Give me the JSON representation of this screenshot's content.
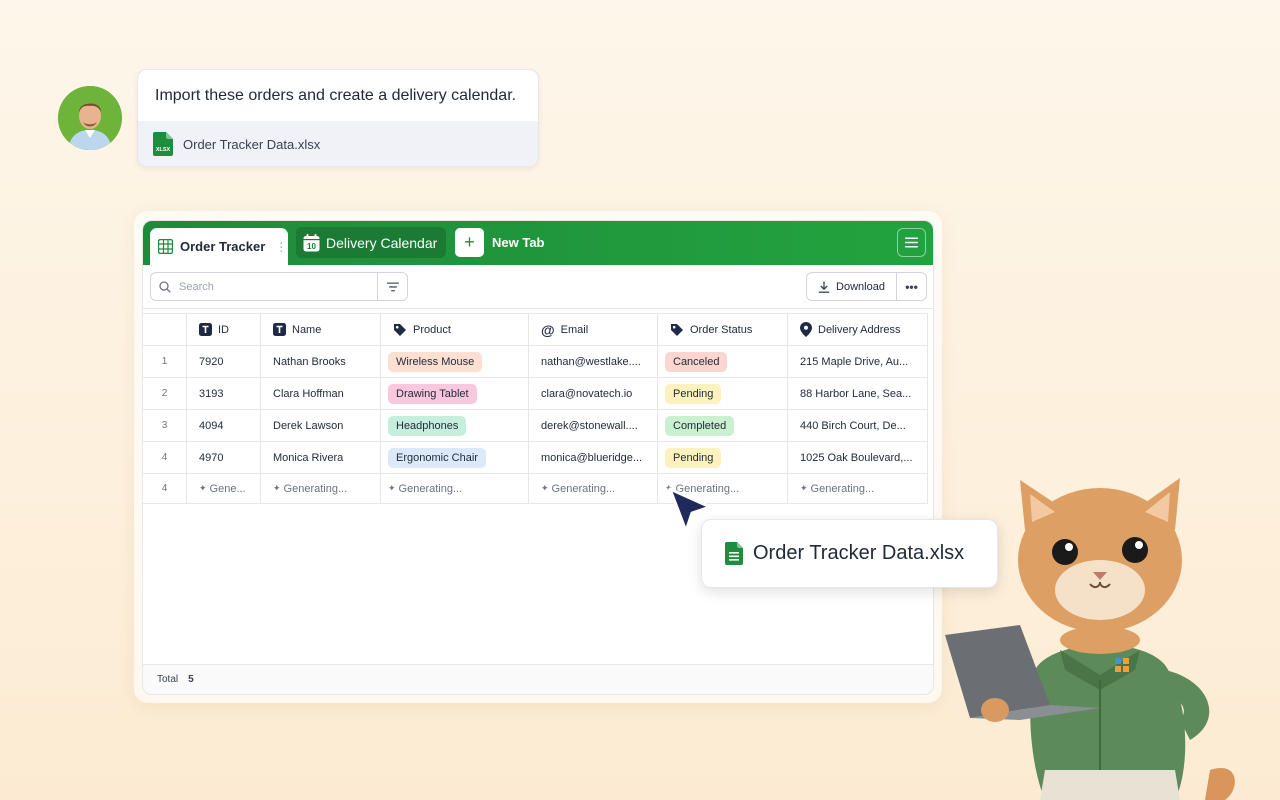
{
  "chat": {
    "message": "Import these orders and create a delivery calendar.",
    "attachment_name": "Order Tracker Data.xlsx",
    "attachment_badge": "XLSX"
  },
  "tabs": {
    "active_label": "Order Tracker",
    "calendar_label": "Delivery Calendar",
    "calendar_day": "10",
    "new_label": "New Tab",
    "new_symbol": "+"
  },
  "toolbar": {
    "search_placeholder": "Search",
    "download_label": "Download",
    "more_label": "•••"
  },
  "table": {
    "columns": [
      "ID",
      "Name",
      "Product",
      "Email",
      "Order Status",
      "Delivery Address"
    ],
    "rows": [
      {
        "num": "1",
        "id": "7920",
        "name": "Nathan Brooks",
        "product": "Wireless Mouse",
        "email": "nathan@westlake....",
        "status": "Canceled",
        "address": "215 Maple Drive, Au..."
      },
      {
        "num": "2",
        "id": "3193",
        "name": "Clara Hoffman",
        "product": "Drawing Tablet",
        "email": "clara@novatech.io",
        "status": "Pending",
        "address": "88 Harbor Lane, Sea..."
      },
      {
        "num": "3",
        "id": "4094",
        "name": "Derek Lawson",
        "product": "Headphones",
        "email": "derek@stonewall....",
        "status": "Completed",
        "address": "440 Birch Court, De..."
      },
      {
        "num": "4",
        "id": "4970",
        "name": "Monica Rivera",
        "product": "Ergonomic Chair",
        "email": "monica@blueridge...",
        "status": "Pending",
        "address": "1025 Oak Boulevard,..."
      }
    ],
    "generating_row": {
      "num": "4",
      "id": "Gene...",
      "name": "Generating...",
      "product": "Generating...",
      "email": "Generating...",
      "status": "Generating...",
      "address": "Generating..."
    },
    "total_label": "Total",
    "total_value": "5"
  },
  "drag_file": {
    "name": "Order Tracker Data.xlsx"
  },
  "colors": {
    "brand_green": "#22a33f",
    "tab_dark": "#1b7a33",
    "product_pills": [
      "#fde0d2",
      "#f9c7de",
      "#c6eedd",
      "#dbe9fb"
    ],
    "status_canceled": "#fbd5d0",
    "status_pending": "#fdf1c0",
    "status_completed": "#c9f0cf"
  }
}
